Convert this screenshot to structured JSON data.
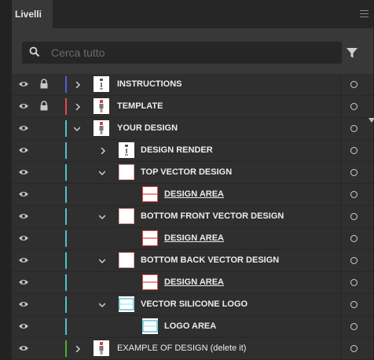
{
  "panel": {
    "tab_label": "Livelli",
    "search_placeholder": "Cerca tutto"
  },
  "colors": {
    "blue": "#4f5fd4",
    "red": "#e24b4b",
    "cyan": "#4fc1c8",
    "green": "#4caf33"
  },
  "layers": [
    {
      "label": "INSTRUCTIONS",
      "level": 0,
      "expand": "collapsed",
      "locked": true,
      "color": "blue",
      "thumb": "doc",
      "style": "bold"
    },
    {
      "label": "TEMPLATE",
      "level": 0,
      "expand": "collapsed",
      "locked": true,
      "color": "red",
      "thumb": "figure",
      "style": "bold"
    },
    {
      "label": "YOUR DESIGN",
      "level": 0,
      "expand": "expanded",
      "locked": false,
      "color": "cyan",
      "thumb": "figure",
      "style": "bold"
    },
    {
      "label": "DESIGN RENDER",
      "level": 1,
      "expand": "collapsed",
      "locked": false,
      "color": "cyan",
      "thumb": "doc",
      "style": "bold"
    },
    {
      "label": "TOP VECTOR DESIGN",
      "level": 1,
      "expand": "expanded",
      "locked": false,
      "color": "cyan",
      "thumb": "redbox",
      "style": "bold"
    },
    {
      "label": "DESIGN AREA",
      "level": 2,
      "expand": "none",
      "locked": false,
      "color": "cyan",
      "thumb": "redline",
      "style": "underline"
    },
    {
      "label": "BOTTOM FRONT VECTOR DESIGN",
      "level": 1,
      "expand": "expanded",
      "locked": false,
      "color": "cyan",
      "thumb": "redbox",
      "style": "bold"
    },
    {
      "label": "DESIGN AREA",
      "level": 2,
      "expand": "none",
      "locked": false,
      "color": "cyan",
      "thumb": "redline",
      "style": "underline"
    },
    {
      "label": "BOTTOM BACK VECTOR DESIGN",
      "level": 1,
      "expand": "expanded",
      "locked": false,
      "color": "cyan",
      "thumb": "redbox",
      "style": "bold"
    },
    {
      "label": "DESIGN AREA",
      "level": 2,
      "expand": "none",
      "locked": false,
      "color": "cyan",
      "thumb": "redline",
      "style": "underline"
    },
    {
      "label": "VECTOR SILICONE LOGO",
      "level": 1,
      "expand": "expanded",
      "locked": false,
      "color": "cyan",
      "thumb": "cyanbox",
      "style": "bold"
    },
    {
      "label": "LOGO AREA",
      "level": 2,
      "expand": "none",
      "locked": false,
      "color": "cyan",
      "thumb": "cyanbox",
      "style": "bold"
    },
    {
      "label": "EXAMPLE OF DESIGN (delete it)",
      "level": 0,
      "expand": "collapsed",
      "locked": false,
      "color": "green",
      "thumb": "figure",
      "style": "normal"
    }
  ]
}
